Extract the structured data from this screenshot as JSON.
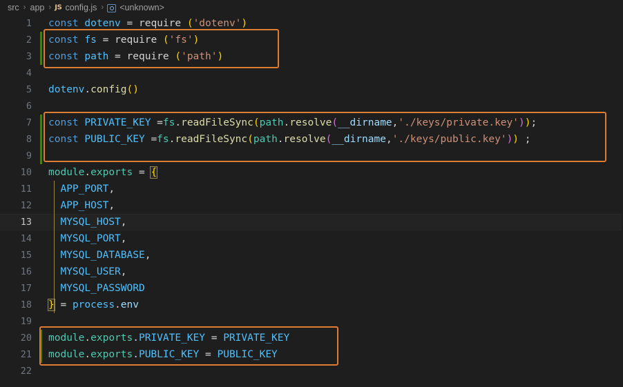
{
  "breadcrumb": {
    "items": [
      {
        "label": "src",
        "icon": null
      },
      {
        "label": "app",
        "icon": null
      },
      {
        "label": "config.js",
        "icon": "js-file-icon"
      },
      {
        "label": "<unknown>",
        "icon": "symbol-misc-icon"
      }
    ],
    "separator": "›"
  },
  "editor": {
    "filename": "config.js",
    "language": "javascript",
    "active_line": 13,
    "total_lines": 22,
    "colors": {
      "background": "#1e1e1e",
      "foreground": "#d4d4d4",
      "line_number": "#6e7681",
      "active_line_number": "#c6c6c6",
      "keyword": "#569cd6",
      "variable": "#9cdcfe",
      "constant": "#4fc1ff",
      "function": "#dcdcaa",
      "class_namespace": "#4ec9b0",
      "string": "#ce9178",
      "bracket_1": "#ffd700",
      "bracket_2": "#da70d6",
      "bracket_3": "#179fff",
      "annotation_box": "#dd7c32",
      "gutter_change": "#4a7c16",
      "indent_guide": "#97854a"
    },
    "lines": [
      {
        "n": "1",
        "text": "const dotenv = require ('dotenv')"
      },
      {
        "n": "2",
        "text": "const fs = require ('fs')"
      },
      {
        "n": "3",
        "text": "const path = require ('path')"
      },
      {
        "n": "4",
        "text": ""
      },
      {
        "n": "5",
        "text": "dotenv.config()"
      },
      {
        "n": "6",
        "text": ""
      },
      {
        "n": "7",
        "text": "const PRIVATE_KEY =fs.readFileSync(path.resolve(__dirname,'./keys/private.key'));"
      },
      {
        "n": "8",
        "text": "const PUBLIC_KEY =fs.readFileSync(path.resolve(__dirname,'./keys/public.key')) ;"
      },
      {
        "n": "9",
        "text": ""
      },
      {
        "n": "10",
        "text": "module.exports = {"
      },
      {
        "n": "11",
        "text": "  APP_PORT,"
      },
      {
        "n": "12",
        "text": "  APP_HOST,"
      },
      {
        "n": "13",
        "text": "  MYSQL_HOST,"
      },
      {
        "n": "14",
        "text": "  MYSQL_PORT,"
      },
      {
        "n": "15",
        "text": "  MYSQL_DATABASE,"
      },
      {
        "n": "16",
        "text": "  MYSQL_USER,"
      },
      {
        "n": "17",
        "text": "  MYSQL_PASSWORD"
      },
      {
        "n": "18",
        "text": "} = process.env"
      },
      {
        "n": "19",
        "text": ""
      },
      {
        "n": "20",
        "text": "module.exports.PRIVATE_KEY = PRIVATE_KEY"
      },
      {
        "n": "21",
        "text": "module.exports.PUBLIC_KEY = PUBLIC_KEY"
      },
      {
        "n": "22",
        "text": ""
      }
    ],
    "annotations": [
      {
        "name": "require-imports-box",
        "lines": "2-3"
      },
      {
        "name": "key-read-box",
        "lines": "7-8"
      },
      {
        "name": "key-exports-box",
        "lines": "20-21"
      }
    ]
  }
}
